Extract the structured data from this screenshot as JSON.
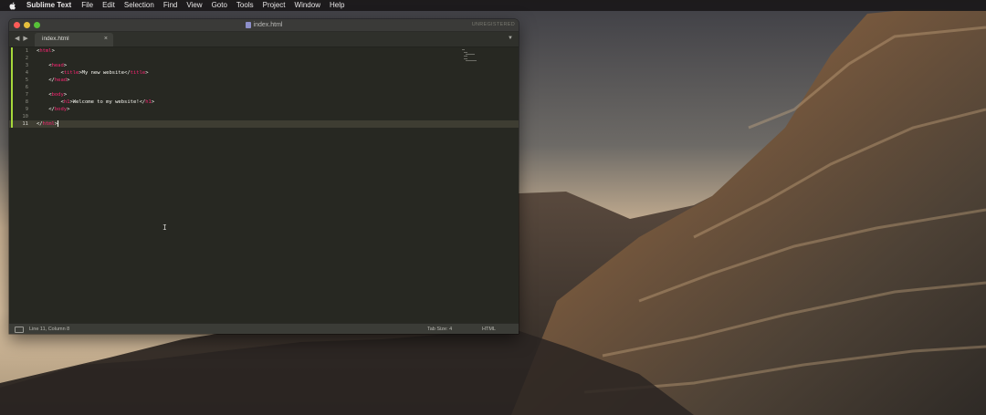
{
  "menubar": {
    "app_name": "Sublime Text",
    "items": [
      "File",
      "Edit",
      "Selection",
      "Find",
      "View",
      "Goto",
      "Tools",
      "Project",
      "Window",
      "Help"
    ]
  },
  "window": {
    "title": "index.html",
    "unregistered": "UNREGISTERED",
    "nav_arrows": "◀ ▶",
    "tab": {
      "label": "index.html",
      "close": "×"
    },
    "tab_menu": "▼"
  },
  "editor": {
    "active_line": 11,
    "line_numbers": [
      "1",
      "2",
      "3",
      "4",
      "5",
      "6",
      "7",
      "8",
      "9",
      "10",
      "11"
    ],
    "lines": [
      [
        {
          "t": "<",
          "c": "tx"
        },
        {
          "t": "html",
          "c": "tag"
        },
        {
          "t": ">",
          "c": "tx"
        }
      ],
      [],
      [
        {
          "t": "    <",
          "c": "tx"
        },
        {
          "t": "head",
          "c": "tag"
        },
        {
          "t": ">",
          "c": "tx"
        }
      ],
      [
        {
          "t": "        <",
          "c": "tx"
        },
        {
          "t": "title",
          "c": "tag"
        },
        {
          "t": ">My new website</",
          "c": "tx"
        },
        {
          "t": "title",
          "c": "tag"
        },
        {
          "t": ">",
          "c": "tx"
        }
      ],
      [
        {
          "t": "    </",
          "c": "tx"
        },
        {
          "t": "head",
          "c": "tag"
        },
        {
          "t": ">",
          "c": "tx"
        }
      ],
      [],
      [
        {
          "t": "    <",
          "c": "tx"
        },
        {
          "t": "body",
          "c": "tag"
        },
        {
          "t": ">",
          "c": "tx"
        }
      ],
      [
        {
          "t": "        <",
          "c": "tx"
        },
        {
          "t": "h1",
          "c": "tag"
        },
        {
          "t": ">Welcome to my website!</",
          "c": "tx"
        },
        {
          "t": "h1",
          "c": "tag"
        },
        {
          "t": ">",
          "c": "tx"
        }
      ],
      [
        {
          "t": "    </",
          "c": "tx"
        },
        {
          "t": "body",
          "c": "tag"
        },
        {
          "t": ">",
          "c": "tx"
        }
      ],
      [],
      [
        {
          "t": "</",
          "c": "tx"
        },
        {
          "t": "html",
          "c": "tag"
        },
        {
          "t": ">",
          "c": "tx"
        }
      ]
    ]
  },
  "statusbar": {
    "position": "Line 11, Column 8",
    "tab_size": "Tab Size: 4",
    "syntax": "HTML"
  },
  "colors": {
    "editor_bg": "#272822",
    "tag": "#f92672",
    "text": "#f8f8f2",
    "modified_marker": "#a6d83a"
  }
}
